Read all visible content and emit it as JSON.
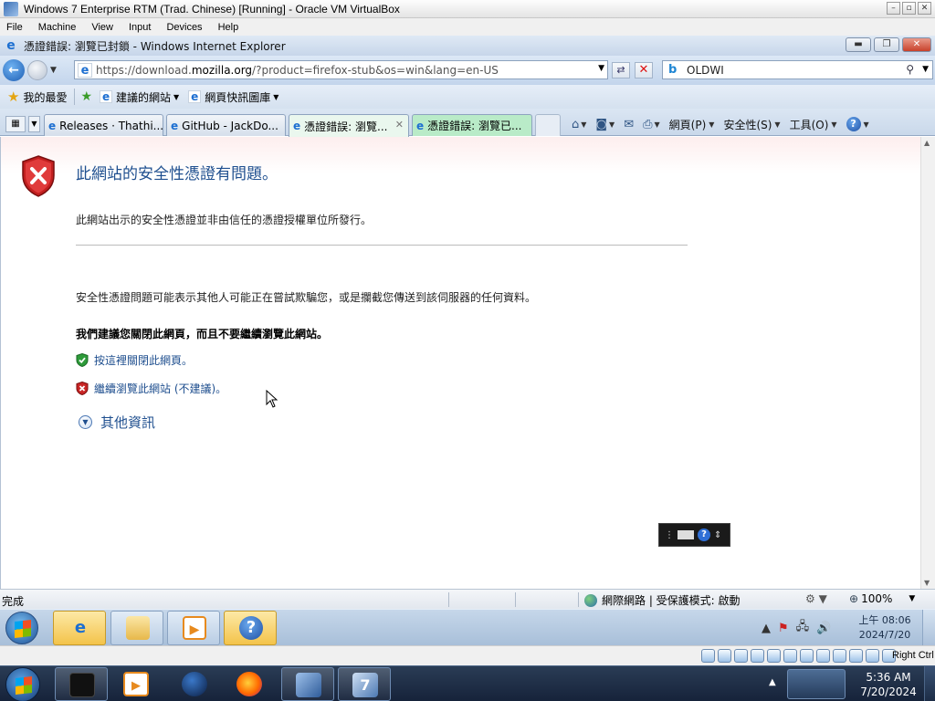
{
  "host_window": {
    "title": "Windows 7 Enterprise RTM (Trad. Chinese) [Running] - Oracle VM VirtualBox",
    "menu": [
      "File",
      "Machine",
      "View",
      "Input",
      "Devices",
      "Help"
    ],
    "host_key": "Right Ctrl"
  },
  "browser": {
    "window_title": "憑證錯誤: 瀏覽已封鎖 - Windows Internet Explorer",
    "address_url_prefix": "https://download.",
    "address_url_domain": "mozilla.org",
    "address_url_rest": "/?product=firefox-stub&os=win&lang=en-US",
    "search_value": "OLDWI",
    "favorites_label": "我的最愛",
    "suggested_sites": "建議的網站",
    "web_slice_gallery": "網頁快訊圖庫",
    "tabs": [
      {
        "label": "Releases · Thathi..."
      },
      {
        "label": "GitHub - JackDo..."
      },
      {
        "label": "憑證錯誤: 瀏覽..."
      },
      {
        "label": "憑證錯誤: 瀏覽已..."
      }
    ],
    "commands": {
      "page": "網頁(P)",
      "safety": "安全性(S)",
      "tools": "工具(O)"
    }
  },
  "page": {
    "title": "此網站的安全性憑證有問題。",
    "line1": "此網站出示的安全性憑證並非由信任的憑證授權單位所發行。",
    "line2": "安全性憑證問題可能表示其他人可能正在嘗試欺騙您，或是攔截您傳送到該伺服器的任何資料。",
    "recommend": "我們建議您關閉此網頁，而且不要繼續瀏覽此網站。",
    "close_link": "按這裡關閉此網頁。",
    "continue_link": "繼續瀏覽此網站 (不建議)。",
    "more_info": "其他資訊"
  },
  "status": {
    "text": "完成",
    "zone": "網際網路 | 受保護模式: 啟動",
    "zoom": "100%"
  },
  "guest_clock": {
    "time": "上午 08:06",
    "date": "2024/7/20"
  },
  "host_clock": {
    "time": "5:36 AM",
    "date": "7/20/2024"
  }
}
